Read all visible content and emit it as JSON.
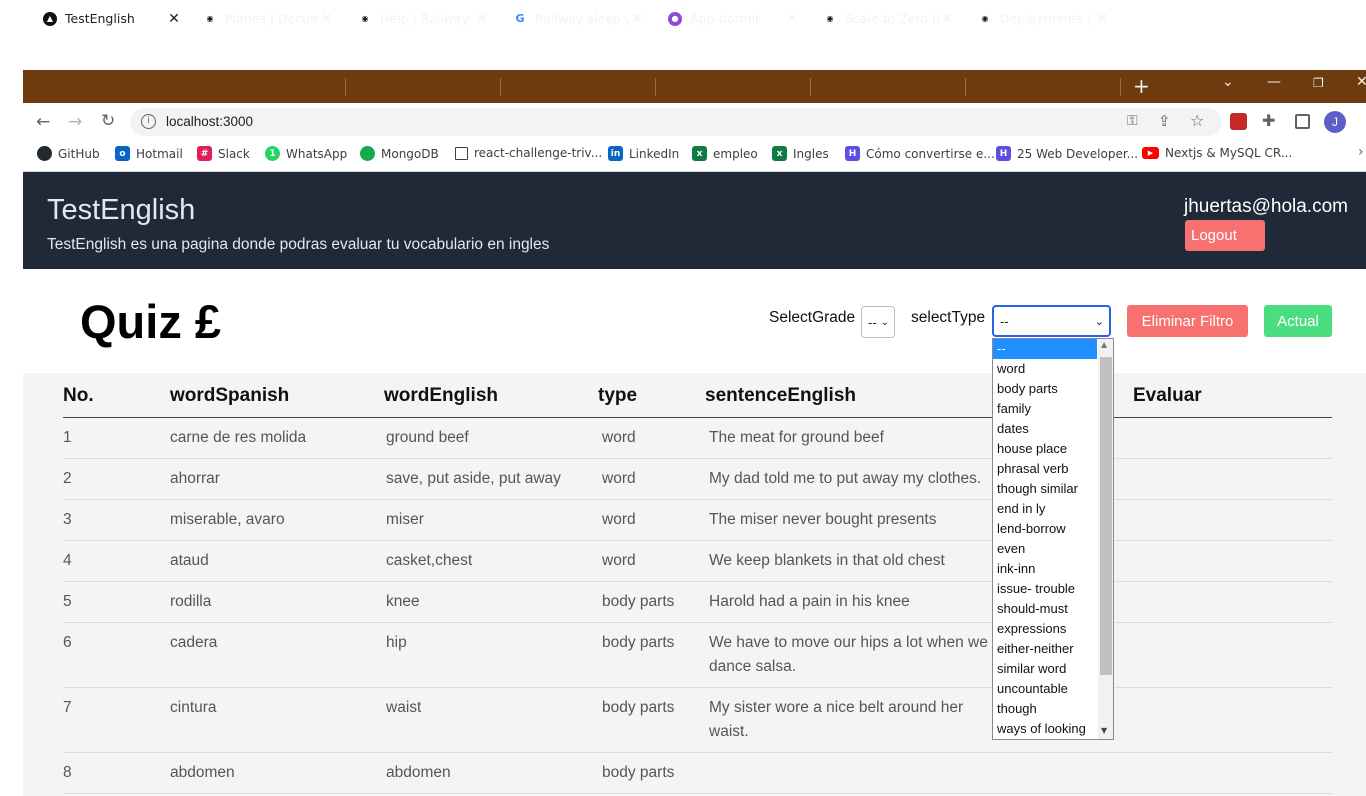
{
  "browser": {
    "tabs": [
      {
        "title": "TestEnglish",
        "active": true
      },
      {
        "title": "Planes | Documen",
        "active": false
      },
      {
        "title": "Help | Railway",
        "active": false
      },
      {
        "title": "Railway sleep you",
        "active": false
      },
      {
        "title": "App-dormir",
        "active": false
      },
      {
        "title": "Scale to Zero (Pa",
        "active": false
      },
      {
        "title": "Deployments | Ra",
        "active": false
      }
    ],
    "address": "localhost:3000",
    "bookmarks": [
      {
        "label": "GitHub",
        "color": "#24292e"
      },
      {
        "label": "Hotmail",
        "color": "#0a64c8"
      },
      {
        "label": "Slack",
        "color": "#e01e5a"
      },
      {
        "label": "WhatsApp",
        "color": "#25d366"
      },
      {
        "label": "MongoDB",
        "color": "#13aa52"
      },
      {
        "label": "react-challenge-triv...",
        "color": "#ffffff"
      },
      {
        "label": "LinkedIn",
        "color": "#0a66c2"
      },
      {
        "label": "empleo",
        "color": "#107c41"
      },
      {
        "label": "Ingles",
        "color": "#107c41"
      },
      {
        "label": "Cómo convertirse e...",
        "color": "#5c4ee5"
      },
      {
        "label": "25 Web Developer...",
        "color": "#5c4ee5"
      },
      {
        "label": "Nextjs & MySQL CR...",
        "color": "#ff0000"
      }
    ],
    "profile_initial": "J"
  },
  "header": {
    "brand": "TestEnglish",
    "tagline": "TestEnglish es una pagina donde podras evaluar tu vocabulario en ingles",
    "email": "jhuertas@hola.com",
    "logout": "Logout"
  },
  "quiz": {
    "title": "Quiz £",
    "select_grade_label": "SelectGrade",
    "select_grade_value": "--",
    "select_type_label": "selectType",
    "select_type_value": "--",
    "clear_filter": "Eliminar Filtro",
    "current": "Actual"
  },
  "type_options": [
    "--",
    "word",
    "body parts",
    "family",
    "dates",
    "house place",
    "phrasal verb",
    "though similar",
    "end in ly",
    "lend-borrow",
    "even",
    "ink-inn",
    "issue- trouble",
    "should-must",
    "expressions",
    "either-neither",
    "similar word",
    "uncountable",
    "though",
    "ways of looking"
  ],
  "table": {
    "headers": [
      "No.",
      "wordSpanish",
      "wordEnglish",
      "type",
      "sentenceEnglish",
      "Evaluar"
    ],
    "rows": [
      {
        "no": "1",
        "es": "carne de res molida",
        "en": "ground beef",
        "type": "word",
        "s1": "The meat for ground beef",
        "s2": ""
      },
      {
        "no": "2",
        "es": "ahorrar",
        "en": "save, put aside, put away",
        "type": "word",
        "s1": "My dad told me to put away my clothes.",
        "s2": ""
      },
      {
        "no": "3",
        "es": "miserable, avaro",
        "en": "miser",
        "type": "word",
        "s1": "The miser never bought presents",
        "s2": ""
      },
      {
        "no": "4",
        "es": "ataud",
        "en": "casket,chest",
        "type": "word",
        "s1": "We keep blankets in that old chest",
        "s2": ""
      },
      {
        "no": "5",
        "es": "rodilla",
        "en": "knee",
        "type": "body parts",
        "s1": "Harold had a pain in his knee",
        "s2": ""
      },
      {
        "no": "6",
        "es": "cadera",
        "en": "hip",
        "type": "body parts",
        "s1": "We have to move our hips a lot when we",
        "s2": "dance salsa."
      },
      {
        "no": "7",
        "es": "cintura",
        "en": "waist",
        "type": "body parts",
        "s1": "My sister wore a nice belt around her",
        "s2": "waist."
      },
      {
        "no": "8",
        "es": "abdomen",
        "en": "abdomen",
        "type": "body parts",
        "s1": "",
        "s2": ""
      }
    ]
  },
  "colors": {
    "header_bg": "#1f2937",
    "logout": "#f87171",
    "clear_filter": "#f87171",
    "current": "#4ade80",
    "selected_option": "#1e90ff",
    "tab_strip": "#6e3b0e"
  }
}
